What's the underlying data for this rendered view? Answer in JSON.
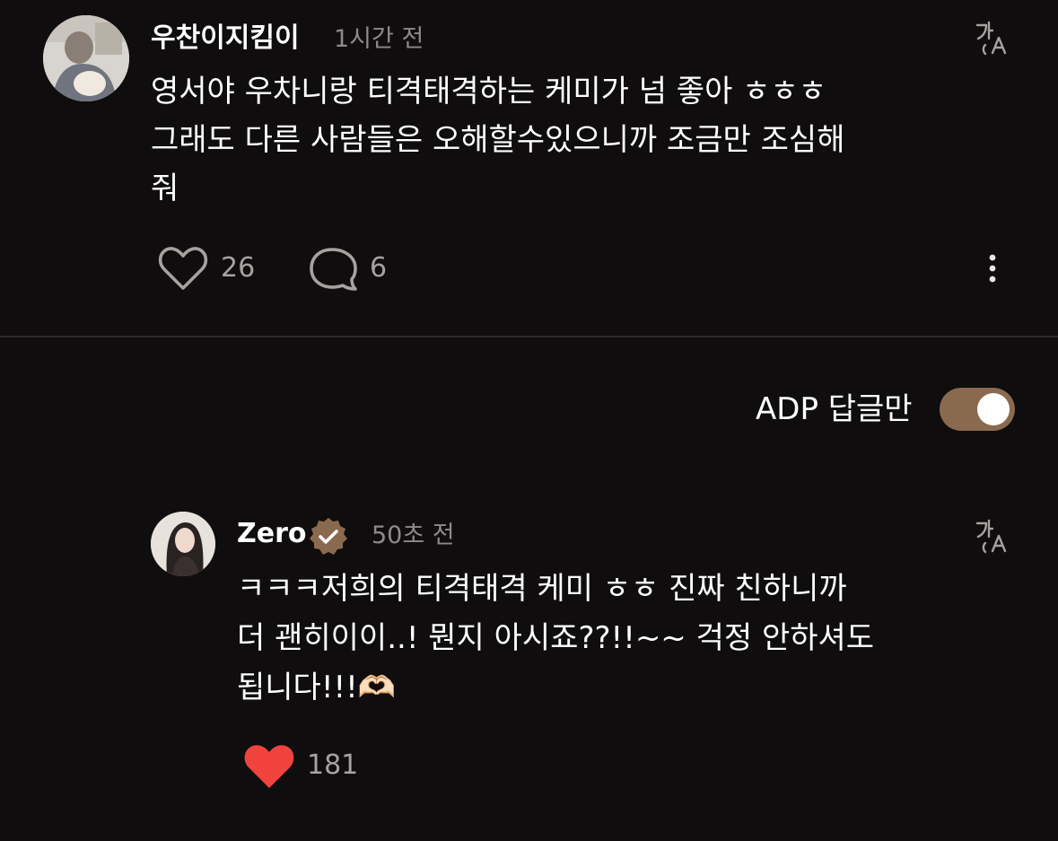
{
  "comment": {
    "username": "우찬이지킴이",
    "time": "1시간 전",
    "text_lines": [
      "영서야 우차니랑 티격태격하는 케미가 넘 좋아 ㅎㅎㅎ",
      "그래도 다른 사람들은 오해할수있으니까 조금만 조심해",
      "줘"
    ],
    "like_count": "26",
    "reply_count": "6",
    "icons": {
      "translate": "translate-icon",
      "like": "heart-outline-icon",
      "reply": "speech-bubble-icon",
      "more": "more-vertical-icon"
    }
  },
  "filter": {
    "label": "ADP 답글만",
    "enabled": true,
    "accent_color": "#8a6a4f"
  },
  "reply": {
    "username": "Zero",
    "verified": true,
    "time": "50초 전",
    "text_lines": [
      "ㅋㅋㅋ저희의  티격태격 케미 ㅎㅎ 진짜 친하니까",
      "더 괜히이이..! 뭔지 아시죠??!!~~ 걱정 안하셔도",
      "됩니다!!!🫶🏻"
    ],
    "like_count": "181",
    "liked": true,
    "like_color": "#f0433d",
    "icons": {
      "translate": "translate-icon",
      "like": "heart-filled-icon",
      "verified": "verified-badge-icon"
    }
  }
}
